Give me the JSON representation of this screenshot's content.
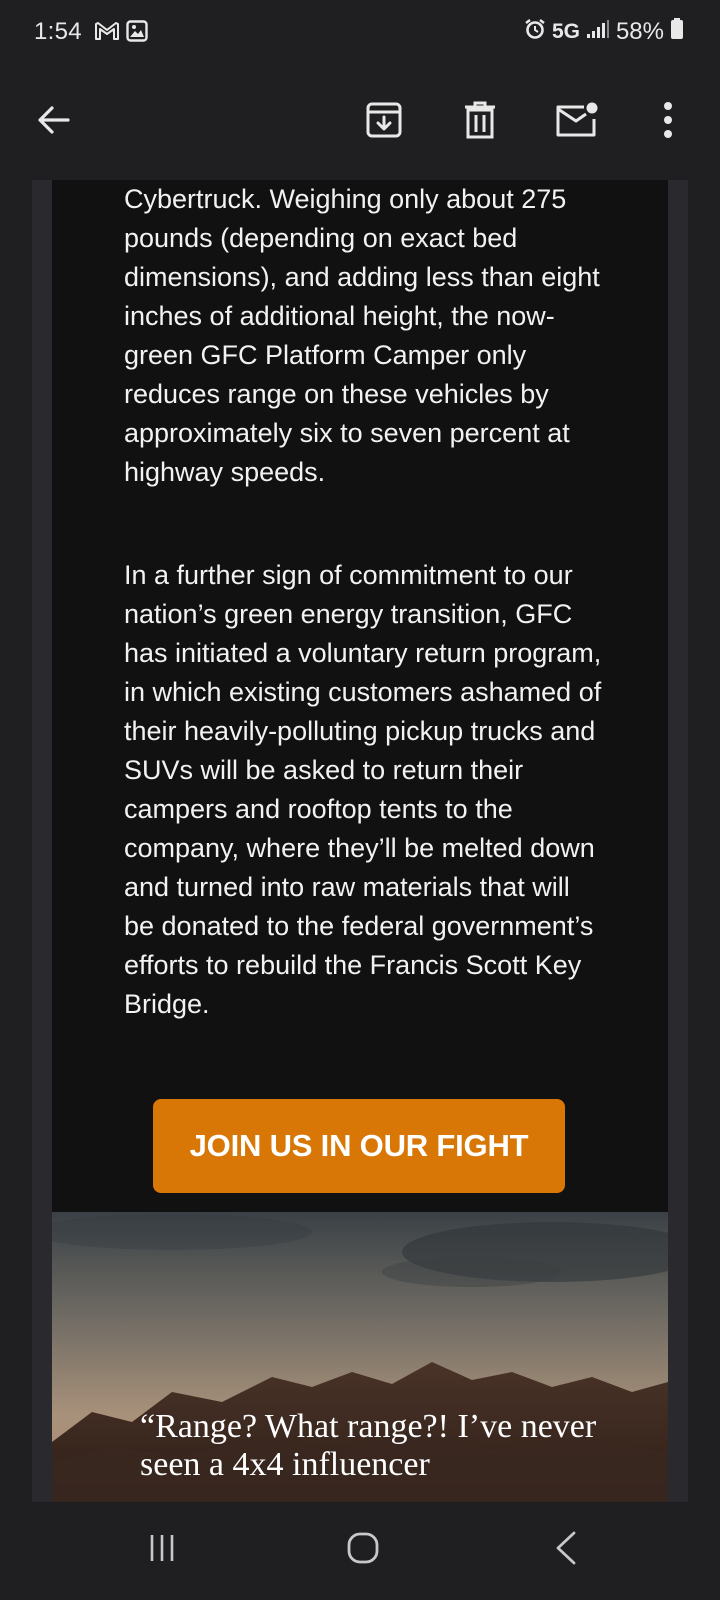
{
  "status_bar": {
    "time": "1:54",
    "network": "5G",
    "battery": "58%",
    "icons": [
      "gmail-icon",
      "image-icon",
      "alarm-icon",
      "signal-icon",
      "battery-icon"
    ]
  },
  "toolbar": {
    "icons": [
      "back-arrow-icon",
      "archive-icon",
      "trash-icon",
      "mark-unread-icon",
      "more-vert-icon"
    ]
  },
  "email": {
    "paragraph_1": "Cybertruck. Weighing only about 275 pounds (depending on exact bed dimensions), and adding less than eight inches of additional height, the now-green GFC Platform Camper only reduces range on these vehicles by approximately six to seven percent at highway speeds.",
    "paragraph_2": "In a further sign of commitment to our nation’s green energy transition, GFC has initiated a voluntary return program, in which existing customers ashamed of their heavily-polluting pickup trucks and SUVs will be asked to return their campers and rooftop tents to the company, where they’ll be melted down and turned into raw materials that will be donated to the federal government’s efforts to rebuild the Francis Scott Key Bridge.",
    "cta_label": "JOIN US IN OUR FIGHT",
    "hero_quote": "“Range? What range?! I’ve never seen a 4x4 influencer"
  },
  "colors": {
    "background": "#1f1f22",
    "email_background": "#111112",
    "cta": "#d97706",
    "text": "#f2f2f2"
  },
  "nav_bar": {
    "icons": [
      "recents-icon",
      "home-icon",
      "nav-back-icon"
    ]
  }
}
